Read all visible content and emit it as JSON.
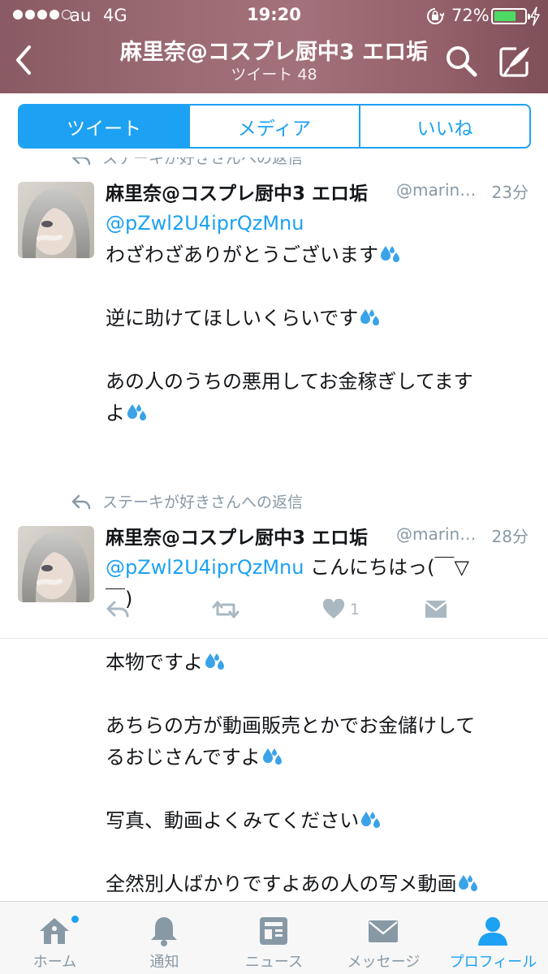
{
  "status_bar": {
    "carrier": "au",
    "network": "4G",
    "time": "19:20",
    "battery_percent": "72%",
    "battery_level": 0.72,
    "battery_color": "#4cd964"
  },
  "header": {
    "title": "麻里奈@コスプレ厨中3 エロ垢",
    "subtitle": "ツイート 48",
    "background": "#946069"
  },
  "tabs": [
    {
      "label": "ツイート",
      "selected": true
    },
    {
      "label": "メディア",
      "selected": false
    },
    {
      "label": "いいね",
      "selected": false
    }
  ],
  "accent_color": "#1da1f2",
  "tweets": [
    {
      "reply_context": "ステーキが好きさんへの返信",
      "name": "麻里奈@コスプレ厨中3 エロ垢",
      "handle": "@marin…",
      "time": "23分",
      "mention": "@pZwl2U4iprQzMnu",
      "lines": [
        "わざわざありがとうございます",
        "逆に助けてほしいくらいです",
        "あの人のうちの悪用してお金稼ぎしてます",
        "よ"
      ],
      "like_count": "1"
    },
    {
      "reply_context": "ステーキが好きさんへの返信",
      "name": "麻里奈@コスプレ厨中3 エロ垢",
      "handle": "@marin…",
      "time": "28分",
      "mention": "@pZwl2U4iprQzMnu",
      "mention_suffix": " こんにちはっ(￣▽",
      "lines": [
        "￣)",
        "本物ですよ",
        "あちらの方が動画販売とかでお金儲けして",
        "るおじさんですよ",
        "写真、動画よくみてください",
        "全然別人ばかりですよあの人の写メ動画"
      ]
    }
  ],
  "tab_bar": [
    {
      "label": "ホーム",
      "icon": "home-icon"
    },
    {
      "label": "通知",
      "icon": "bell-icon"
    },
    {
      "label": "ニュース",
      "icon": "news-icon"
    },
    {
      "label": "メッセージ",
      "icon": "envelope-icon"
    },
    {
      "label": "プロフィール",
      "icon": "person-icon"
    }
  ]
}
